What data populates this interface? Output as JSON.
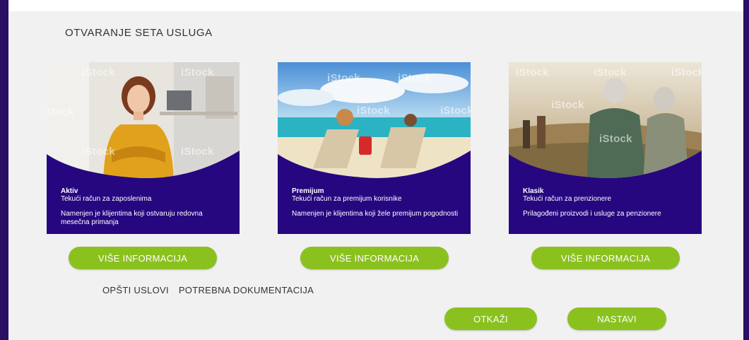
{
  "page": {
    "title": "OTVARANJE SETA USLUGA",
    "watermark": "iStock"
  },
  "cards": [
    {
      "name": "Aktiv",
      "subtitle": "Tekući račun za zaposlenima",
      "description": "Namenjen je klijentima koji ostvaruju redovna mesečna primanja",
      "button_label": "VIŠE INFORMACIJA"
    },
    {
      "name": "Premijum",
      "subtitle": "Tekući račun za premijum korisnike",
      "description": "Namenjen je klijentima koji žele premijum pogodnosti",
      "button_label": "VIŠE INFORMACIJA"
    },
    {
      "name": "Klasik",
      "subtitle": "Tekući račun za prenzionere",
      "description": "Prilagođeni proizvodi i usluge za penzionere",
      "button_label": "VIŠE INFORMACIJA"
    }
  ],
  "links": {
    "general_terms": "OPŠTI USLOVI",
    "documentation": "POTREBNA DOKUMENTACIJA"
  },
  "actions": {
    "cancel_label": "OTKAŽI",
    "continue_label": "NASTAVI"
  },
  "colors": {
    "card_background": "#260780",
    "button_green": "#8bc11e",
    "panel_background": "#f1f1f1",
    "frame": "#2a0f63"
  }
}
